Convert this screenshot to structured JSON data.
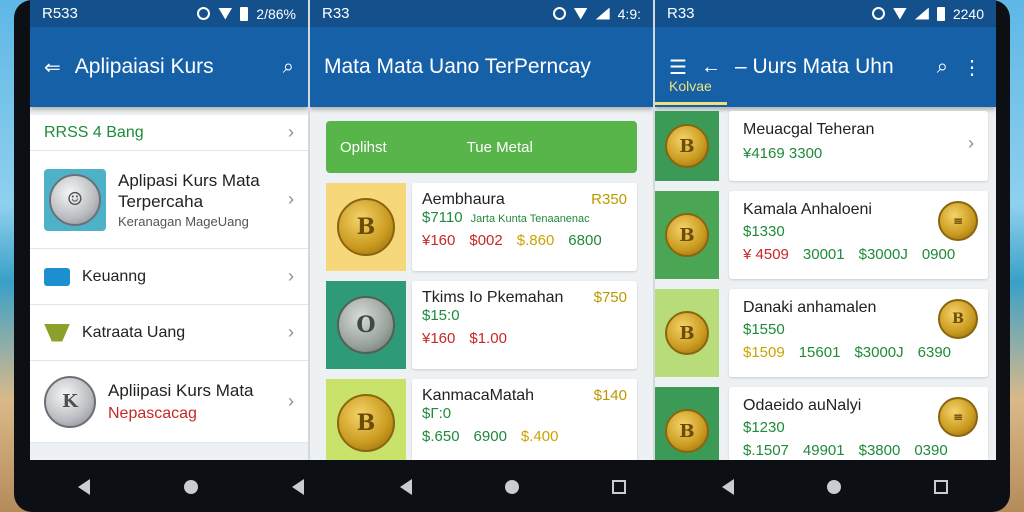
{
  "panes": [
    {
      "status": {
        "left": "R533",
        "right": "2/86%"
      },
      "appbar": {
        "title": "Aplipaiasi Kurs"
      },
      "header_row": "RRSS 4 Bang",
      "rows": [
        {
          "title": "Aplipasi Kurs Mata Terpercaha",
          "sub": "Keranagan MageUang"
        },
        {
          "title": "Keuanng"
        },
        {
          "title": "Katraata Uang"
        },
        {
          "title": "Apliipasi Kurs Mata",
          "sub": "Nepascacag"
        }
      ]
    },
    {
      "status": {
        "left": "R33",
        "right": "4:9:"
      },
      "appbar": {
        "title": "Mata Mata Uano TerPerncay"
      },
      "banner": {
        "left": "Oplihst",
        "right": "Tue Metal"
      },
      "rows": [
        {
          "name": "Aembhaura",
          "price": "R350",
          "sub": "$7110",
          "sub2": "Jarta Kunta Tenaanenac",
          "vals": [
            "¥160",
            "$002",
            "$.860",
            "6800"
          ]
        },
        {
          "name": "Tkims Io Pkemahan",
          "price": "$750",
          "sub": "$15:0",
          "vals": [
            "¥160",
            "$1.00"
          ]
        },
        {
          "name": "KanmacaMatah",
          "price": "$140",
          "sub": "$Γ:0",
          "vals": [
            "$.650",
            "6900",
            "$.400"
          ]
        }
      ]
    },
    {
      "status": {
        "left": "R33",
        "right": "2240"
      },
      "appbar": {
        "title": "Uurs Mata Uhn"
      },
      "tab": "Kolvae",
      "rows": [
        {
          "name": "Meuacgal Teheran",
          "sub": "¥4169  3300"
        },
        {
          "name": "Kamala Anhaloeni",
          "sub": "$1330",
          "vals": [
            "¥ 4509",
            "30001",
            "$3000J",
            "0900"
          ]
        },
        {
          "name": "Danaki anhamalen",
          "sub": "$1550",
          "vals": [
            "$1509",
            "15601",
            "$3000J",
            "6390"
          ]
        },
        {
          "name": "Odaeido auNalyi",
          "sub": "$1230",
          "vals": [
            "$.1507",
            "49901",
            "$3800",
            "0390"
          ]
        }
      ]
    }
  ]
}
